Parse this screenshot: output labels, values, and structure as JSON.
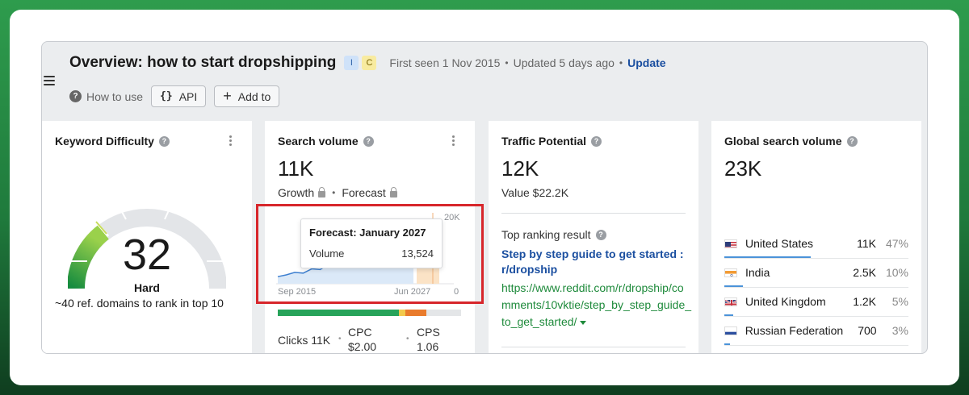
{
  "header": {
    "title": "Overview: how to start dropshipping",
    "badges": [
      "I",
      "C"
    ],
    "first_seen": "First seen 1 Nov 2015",
    "updated": "Updated 5 days ago",
    "update_link": "Update"
  },
  "toolbar": {
    "how_to_use": "How to use",
    "api_label": "API",
    "add_to_label": "Add to"
  },
  "keyword_difficulty": {
    "title": "Keyword Difficulty",
    "value": "32",
    "value_number": 32,
    "label": "Hard",
    "description": "~40 ref. domains to rank in top 10"
  },
  "search_volume": {
    "title": "Search volume",
    "value": "11K",
    "growth_label": "Growth",
    "forecast_label": "Forecast",
    "tooltip_title": "Forecast: January 2027",
    "tooltip_metric": "Volume",
    "tooltip_value": "13,524",
    "axis_start": "Sep 2015",
    "axis_end": "Jun 2027",
    "y_max_label": "20K",
    "y_min_label": "0",
    "clicks": "Clicks 11K",
    "cpc_label": "CPC",
    "cpc_value": "$2.00",
    "cps_label": "CPS",
    "cps_value": "1.06",
    "intent_colors": [
      "#27a35a",
      "#f2c94c",
      "#e97b2c",
      "#e4e6e8"
    ]
  },
  "chart_data": {
    "type": "line",
    "x_start": "Sep 2015",
    "x_end": "Jun 2027",
    "ylim": [
      0,
      20000
    ],
    "series": [
      {
        "name": "Volume",
        "values": [
          2000,
          2500,
          3200,
          3000,
          4200,
          4000,
          5500,
          5200,
          6500,
          7000,
          6800,
          8500,
          9000,
          8800,
          10500,
          10000,
          11000
        ]
      },
      {
        "name": "Forecast",
        "values": [
          11000,
          12000,
          13524
        ]
      }
    ],
    "grid": false,
    "legend": "none"
  },
  "traffic_potential": {
    "title": "Traffic Potential",
    "value": "12K",
    "value_sub": "Value $22.2K",
    "top_ranking_label": "Top ranking result",
    "result_title": "Step by step guide to get started : r/dropship",
    "result_url": "https://www.reddit.com/r/dropship/comments/10vktie/step_by_step_guide_to_get_started/"
  },
  "global_search_volume": {
    "title": "Global search volume",
    "value": "23K",
    "countries": [
      {
        "name": "United States",
        "volume": "11K",
        "percent": "47%",
        "share": 0.47
      },
      {
        "name": "India",
        "volume": "2.5K",
        "percent": "10%",
        "share": 0.1
      },
      {
        "name": "United Kingdom",
        "volume": "1.2K",
        "percent": "5%",
        "share": 0.05
      },
      {
        "name": "Russian Federation",
        "volume": "700",
        "percent": "3%",
        "share": 0.03
      }
    ]
  }
}
